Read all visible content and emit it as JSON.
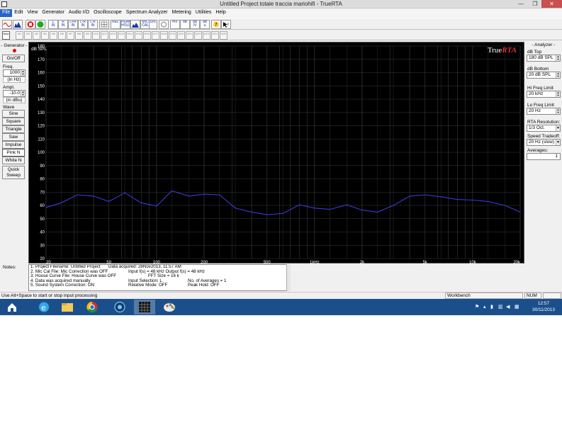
{
  "window": {
    "title": "Untitled Project totale traccia mariohifi - TrueRTA",
    "min_glyph": "—",
    "max_glyph": "❐",
    "close_glyph": "✕"
  },
  "menu": [
    "File",
    "Edit",
    "View",
    "Generator",
    "Audio I/O",
    "Oscilloscope",
    "Spectrum Analyzer",
    "Metering",
    "Utilities",
    "Help"
  ],
  "toolbar": {
    "rel": "REL",
    "spl": "SPL",
    "mv": "mV",
    "db": "dB"
  },
  "toolbar2": {
    "new": "New"
  },
  "generator": {
    "header": "- Generator -",
    "on_off": "On/Off",
    "freq_label": "Freq.",
    "freq_value": "1000",
    "freq_unit": "(in Hz)",
    "ampl_label": "Ampl.",
    "ampl_value": "-10.0",
    "ampl_unit": "(in dBu)",
    "wave_label": "Wave",
    "waves": [
      "Sine",
      "Square",
      "Triangle",
      "Saw",
      "Impulse",
      "Pink N",
      "White N"
    ],
    "quick": "Quick",
    "sweep": "Sweep"
  },
  "analyzer": {
    "header": "- Analyzer -",
    "db_top_label": "dB Top",
    "db_top_value": "180 dB SPL",
    "db_bottom_label": "dB Bottom",
    "db_bottom_value": "20 dB SPL",
    "hi_label": "Hi Freq Limit",
    "hi_value": "20 kHz",
    "lo_label": "Lo Freq Limit",
    "lo_value": "20 Hz",
    "res_label": "RTA Resolution:",
    "res_value": "1/3 Oct.",
    "speed_label": "Speed Tradeoff:",
    "speed_value": "20 Hz (slow)",
    "avg_label": "Averages:",
    "avg_value": "1"
  },
  "chart_data": {
    "type": "line",
    "ylabel": "dB SPL",
    "logo": "TrueRTA",
    "ylim": [
      20,
      180
    ],
    "xlim": [
      20,
      20000
    ],
    "x_scale": "log",
    "y_ticks": [
      20,
      30,
      40,
      50,
      60,
      70,
      80,
      90,
      100,
      110,
      120,
      130,
      140,
      150,
      160,
      170,
      180
    ],
    "x_tick_labels": [
      {
        "f": 20,
        "label": "20"
      },
      {
        "f": 50,
        "label": "50"
      },
      {
        "f": 100,
        "label": "100"
      },
      {
        "f": 200,
        "label": "200"
      },
      {
        "f": 500,
        "label": "500"
      },
      {
        "f": 1000,
        "label": "1kHz"
      },
      {
        "f": 2000,
        "label": "2k"
      },
      {
        "f": 5000,
        "label": "5k"
      },
      {
        "f": 10000,
        "label": "10k"
      },
      {
        "f": 20000,
        "label": "20k"
      }
    ],
    "grid": true,
    "line_color": "#3a3ad8",
    "series": [
      {
        "x": [
          20,
          25,
          31.5,
          40,
          50,
          63,
          80,
          100,
          125,
          160,
          200,
          250,
          315,
          400,
          500,
          630,
          800,
          1000,
          1250,
          1600,
          2000,
          2500,
          3150,
          4000,
          5000,
          6300,
          8000,
          10000,
          12500,
          16000,
          20000
        ],
        "values": [
          58.5,
          62,
          68,
          67,
          63,
          69.5,
          62,
          59.5,
          71,
          67,
          68.5,
          68,
          58,
          55,
          53,
          54,
          60.5,
          58,
          57,
          60.5,
          56.5,
          55,
          60,
          67,
          68,
          66.5,
          64.5,
          64,
          63,
          60,
          55
        ]
      }
    ]
  },
  "notes": {
    "label": "Notes:",
    "rows": [
      [
        "1. Project Filename: Untitled Project",
        "Data acquired: 28Nov2013, 11:57 AM",
        ""
      ],
      [
        "2. Mic Cal File: Mic Correction was OFF",
        "Input f(s) = 48 kHz   Output f(s) = 48 kHz",
        ""
      ],
      [
        "3. House Curve File: House Curve was OFF",
        "FFT Size = 16 k",
        ""
      ],
      [
        "4. Data was acquired manually",
        "Input Selection: L",
        "No. of Averages = 1"
      ],
      [
        "5. Sound System Correction: ON",
        "Relative Mode:  OFF",
        "Peak Hold:  OFF"
      ]
    ]
  },
  "status": {
    "message": "Use Alt+Space to start or stop input processing",
    "workbench": "Workbench",
    "num": "NUM"
  },
  "taskbar": {
    "time": "12:57",
    "date": "30/11/2013"
  },
  "colors": {
    "plot_bg": "#000000",
    "grid": "#3a3a3a",
    "axis_text": "#ffffff",
    "taskbar": "#1b4f8c",
    "logo_rta": "#e03030"
  }
}
